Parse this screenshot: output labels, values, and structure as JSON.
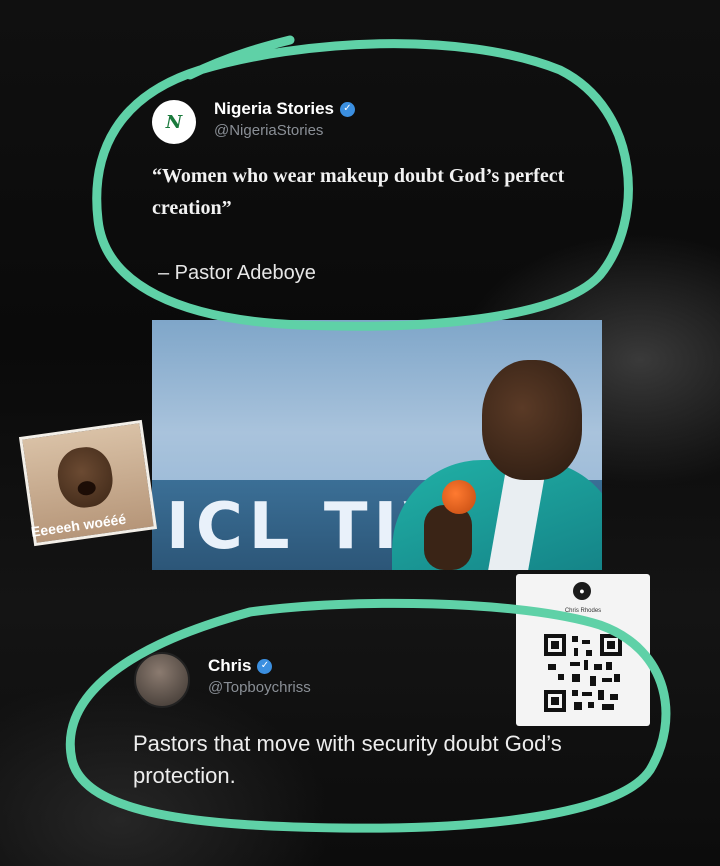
{
  "tweet1": {
    "avatar_text": "N",
    "name": "Nigeria Stories",
    "handle": "@NigeriaStories",
    "quote": "“Women who wear makeup doubt God’s perfect creation”",
    "attribution": "– Pastor Adeboye"
  },
  "photo": {
    "banner_text": "ICL  TIV"
  },
  "sticker": {
    "caption": "Eeeeeh woééé"
  },
  "qr_card": {
    "small_text": "Chris Rhodes"
  },
  "tweet2": {
    "name": "Chris",
    "handle": "@Topboychriss",
    "text": "Pastors that move with security doubt God’s protection."
  },
  "colors": {
    "highlight_ring": "#5fd1a7",
    "verified_badge": "#3b8fe0",
    "handle_gray": "#8a8f96"
  }
}
